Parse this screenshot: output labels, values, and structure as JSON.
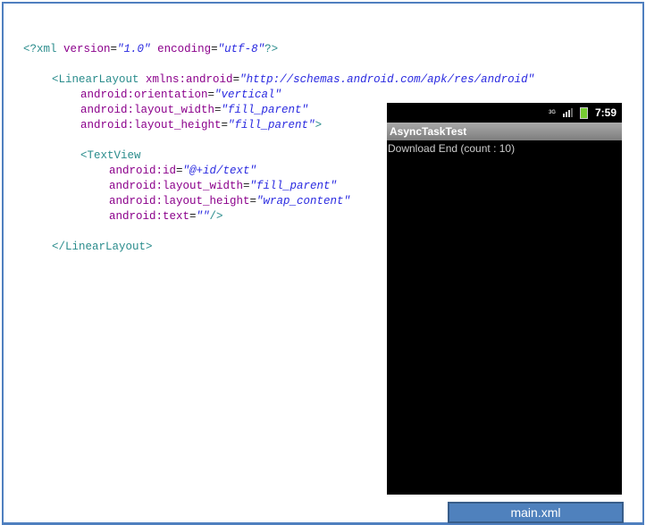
{
  "code_lines": [
    {
      "indent": 0,
      "tokens": [
        [
          "tag",
          "<?xml "
        ],
        [
          "attr",
          "version"
        ],
        [
          "pun",
          "="
        ],
        [
          "val",
          "\"1.0\""
        ],
        [
          "pun",
          " "
        ],
        [
          "attr",
          "encoding"
        ],
        [
          "pun",
          "="
        ],
        [
          "val",
          "\"utf-8\""
        ],
        [
          "tag",
          "?>"
        ]
      ]
    },
    {
      "indent": 1,
      "tokens": [
        [
          "tag",
          "<LinearLayout "
        ],
        [
          "attr",
          "xmlns:android"
        ],
        [
          "pun",
          "="
        ],
        [
          "val",
          "\"http://schemas.android.com/apk/res/android\""
        ]
      ]
    },
    {
      "indent": 2,
      "tokens": [
        [
          "attr",
          "android:orientation"
        ],
        [
          "pun",
          "="
        ],
        [
          "val",
          "\"vertical\""
        ]
      ]
    },
    {
      "indent": 2,
      "tokens": [
        [
          "attr",
          "android:layout_width"
        ],
        [
          "pun",
          "="
        ],
        [
          "val",
          "\"fill_parent\""
        ]
      ]
    },
    {
      "indent": 2,
      "tokens": [
        [
          "attr",
          "android:layout_height"
        ],
        [
          "pun",
          "="
        ],
        [
          "val",
          "\"fill_parent\""
        ],
        [
          "tag",
          ">"
        ]
      ]
    },
    {
      "indent": 2,
      "tokens": [
        [
          "tag",
          "<TextView"
        ]
      ]
    },
    {
      "indent": 3,
      "tokens": [
        [
          "attr",
          "android:id"
        ],
        [
          "pun",
          "="
        ],
        [
          "val",
          "\"@+id/text\""
        ]
      ]
    },
    {
      "indent": 3,
      "tokens": [
        [
          "attr",
          "android:layout_width"
        ],
        [
          "pun",
          "="
        ],
        [
          "val",
          "\"fill_parent\""
        ]
      ]
    },
    {
      "indent": 3,
      "tokens": [
        [
          "attr",
          "android:layout_height"
        ],
        [
          "pun",
          "="
        ],
        [
          "val",
          "\"wrap_content\""
        ]
      ]
    },
    {
      "indent": 3,
      "tokens": [
        [
          "attr",
          "android:text"
        ],
        [
          "pun",
          "="
        ],
        [
          "val",
          "\"\""
        ],
        [
          "tag",
          "/>"
        ]
      ]
    },
    {
      "indent": 1,
      "tokens": [
        [
          "tag",
          "</LinearLayout>"
        ]
      ]
    }
  ],
  "phone": {
    "network": "3G",
    "time": "7:59",
    "app_title": "AsyncTaskTest",
    "text": "Download End (count : 10)"
  },
  "tab_label": "main.xml"
}
